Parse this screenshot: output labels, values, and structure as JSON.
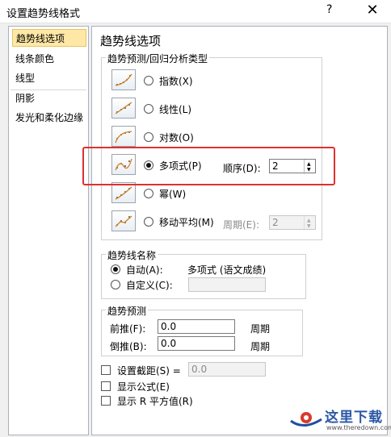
{
  "window": {
    "title": "设置趋势线格式",
    "help_label": "?",
    "close_label": "✕"
  },
  "sidebar": {
    "items": [
      {
        "label": "趋势线选项",
        "active": true
      },
      {
        "label": "线条颜色",
        "active": false
      },
      {
        "label": "线型",
        "active": false
      },
      {
        "label": "阴影",
        "active": false
      },
      {
        "label": "发光和柔化边缘",
        "active": false
      }
    ]
  },
  "main": {
    "heading": "趋势线选项",
    "type_group": {
      "label": "趋势预测/回归分析类型",
      "options": [
        {
          "label": "指数(X)",
          "selected": false,
          "icon": "exponential-trend-icon"
        },
        {
          "label": "线性(L)",
          "selected": false,
          "icon": "linear-trend-icon"
        },
        {
          "label": "对数(O)",
          "selected": false,
          "icon": "logarithmic-trend-icon"
        },
        {
          "label": "多项式(P)",
          "selected": true,
          "icon": "polynomial-trend-icon"
        },
        {
          "label": "幂(W)",
          "selected": false,
          "icon": "power-trend-icon"
        },
        {
          "label": "移动平均(M)",
          "selected": false,
          "icon": "moving-average-trend-icon"
        }
      ],
      "order_label": "顺序(D):",
      "order_value": "2",
      "period_label": "周期(E):",
      "period_value": "2"
    },
    "name_group": {
      "label": "趋势线名称",
      "auto_label": "自动(A):",
      "auto_value": "多项式 (语文成绩)",
      "custom_label": "自定义(C):",
      "custom_value": ""
    },
    "forecast_group": {
      "label": "趋势预测",
      "forward_label": "前推(F):",
      "forward_value": "0.0",
      "backward_label": "倒推(B):",
      "backward_value": "0.0",
      "unit": "周期"
    },
    "intercept_label": "设置截距(S) =",
    "intercept_value": "0.0",
    "show_equation_label": "显示公式(E)",
    "show_r2_label": "显示 R 平方值(R)"
  },
  "watermark": {
    "text": "这里下载",
    "url": "www.theredown.com"
  }
}
